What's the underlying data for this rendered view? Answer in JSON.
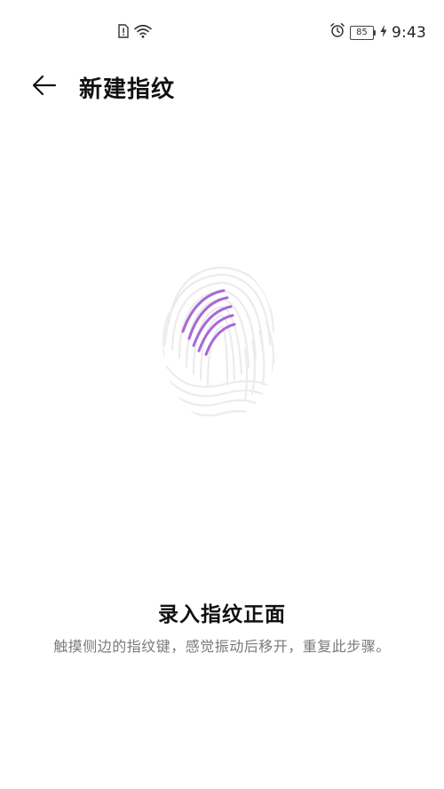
{
  "status_bar": {
    "sim_icon": "sim-alert-icon",
    "wifi_icon": "wifi-icon",
    "alarm_icon": "alarm-icon",
    "battery_level": "85",
    "charging_icon": "charging-bolt-icon",
    "time": "9:43"
  },
  "app_bar": {
    "back_icon": "arrow-left-icon",
    "title": "新建指纹"
  },
  "fingerprint": {
    "icon": "fingerprint-icon",
    "accent_color": "#a769d6",
    "ridge_color": "#ececec"
  },
  "instruction": {
    "title": "录入指纹正面",
    "text": "触摸侧边的指纹键，感觉振动后移开，重复此步骤。"
  }
}
